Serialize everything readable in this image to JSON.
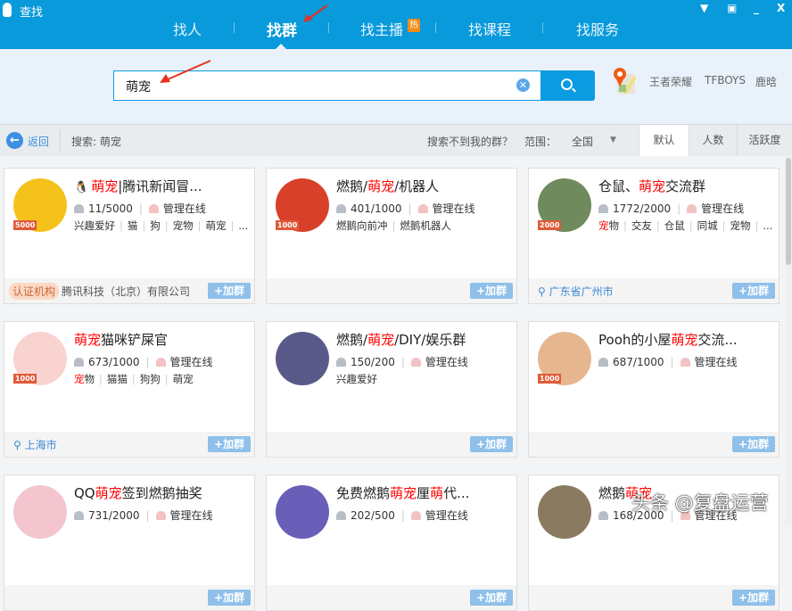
{
  "window": {
    "title": "查找",
    "controls": [
      "pin",
      "lock",
      "minimize",
      "close"
    ]
  },
  "nav": {
    "items": [
      "找人",
      "找群",
      "找主播",
      "找课程",
      "找服务"
    ],
    "active": "找群",
    "hot_badge": "热"
  },
  "search": {
    "value": "萌宠",
    "hot_words": [
      "王者荣耀",
      "TFBOYS",
      "鹿晗"
    ]
  },
  "toolbar": {
    "back": "返回",
    "query_label": "搜索: 萌宠",
    "not_found": "搜索不到我的群？",
    "range_label": "范围：",
    "range_value": "全国",
    "sort_tabs": [
      "默认",
      "人数",
      "活跃度"
    ],
    "active_sort": "默认"
  },
  "join_label": "+加群",
  "online_label": "管理在线",
  "cards": [
    {
      "title": [
        {
          "t": "萌宠",
          "hl": true
        },
        {
          "t": "|腾讯新闻冒..."
        }
      ],
      "qq_icon": true,
      "members": "11/5000",
      "badge": "5000",
      "tags": [
        [
          {
            "t": "兴趣爱好"
          }
        ],
        [
          {
            "t": "猫"
          }
        ],
        [
          {
            "t": "狗"
          }
        ],
        [
          {
            "t": "宠物"
          }
        ],
        [
          {
            "t": "萌宠"
          }
        ],
        [
          {
            "t": "..."
          }
        ]
      ],
      "cert": "认证机构",
      "org": "腾讯科技（北京）有限公司",
      "avatar": "#f5c21b"
    },
    {
      "title": [
        {
          "t": "燃鹅/"
        },
        {
          "t": "萌宠",
          "hl": true
        },
        {
          "t": "/机器人"
        }
      ],
      "members": "401/1000",
      "badge": "1000",
      "tags": [
        [
          {
            "t": "燃鹅向前冲"
          }
        ],
        [
          {
            "t": "燃鹅机器人"
          }
        ]
      ],
      "avatar": "#d8402a"
    },
    {
      "title": [
        {
          "t": "仓鼠、"
        },
        {
          "t": "萌宠",
          "hl": true
        },
        {
          "t": "交流群"
        }
      ],
      "members": "1772/2000",
      "badge": "2000",
      "tags": [
        [
          {
            "t": "宠",
            "hl": true
          },
          {
            "t": "物"
          }
        ],
        [
          {
            "t": "交友"
          }
        ],
        [
          {
            "t": "仓鼠"
          }
        ],
        [
          {
            "t": "同城"
          }
        ],
        [
          {
            "t": "宠物"
          }
        ],
        [
          {
            "t": "..."
          }
        ]
      ],
      "location": "广东省广州市",
      "avatar": "#6f8a5c"
    },
    {
      "title": [
        {
          "t": "萌宠",
          "hl": true
        },
        {
          "t": "猫咪铲屎官"
        }
      ],
      "members": "673/1000",
      "badge": "1000",
      "tags": [
        [
          {
            "t": "宠",
            "hl": true
          },
          {
            "t": "物"
          }
        ],
        [
          {
            "t": "猫猫"
          }
        ],
        [
          {
            "t": "狗狗"
          }
        ],
        [
          {
            "t": "萌宠"
          }
        ]
      ],
      "location": "上海市",
      "avatar": "#f9d3cf"
    },
    {
      "title": [
        {
          "t": "燃鹅/"
        },
        {
          "t": "萌宠",
          "hl": true
        },
        {
          "t": "/DIY/娱乐群"
        }
      ],
      "members": "150/200",
      "tags": [
        [
          {
            "t": "兴趣爱好"
          }
        ]
      ],
      "avatar": "#5a5a8a"
    },
    {
      "title": [
        {
          "t": "Pooh的小屋"
        },
        {
          "t": "萌宠",
          "hl": true
        },
        {
          "t": "交流..."
        }
      ],
      "members": "687/1000",
      "badge": "1000",
      "tags": [],
      "avatar": "#e6b78e"
    },
    {
      "title": [
        {
          "t": "QQ"
        },
        {
          "t": "萌宠",
          "hl": true
        },
        {
          "t": "签到燃鹅抽奖"
        }
      ],
      "members": "731/2000",
      "tags": [],
      "avatar": "#f3c6cf"
    },
    {
      "title": [
        {
          "t": "免费燃鹅"
        },
        {
          "t": "萌宠",
          "hl": true
        },
        {
          "t": "厘"
        },
        {
          "t": "萌",
          "hl": true
        },
        {
          "t": "代..."
        }
      ],
      "members": "202/500",
      "tags": [],
      "avatar": "#6a5fb8"
    },
    {
      "title": [
        {
          "t": "燃鹅"
        },
        {
          "t": "萌宠",
          "hl": true
        }
      ],
      "members": "168/2000",
      "tags": [],
      "avatar": "#8a7a60"
    }
  ],
  "watermark": "头条 @复盘运营"
}
